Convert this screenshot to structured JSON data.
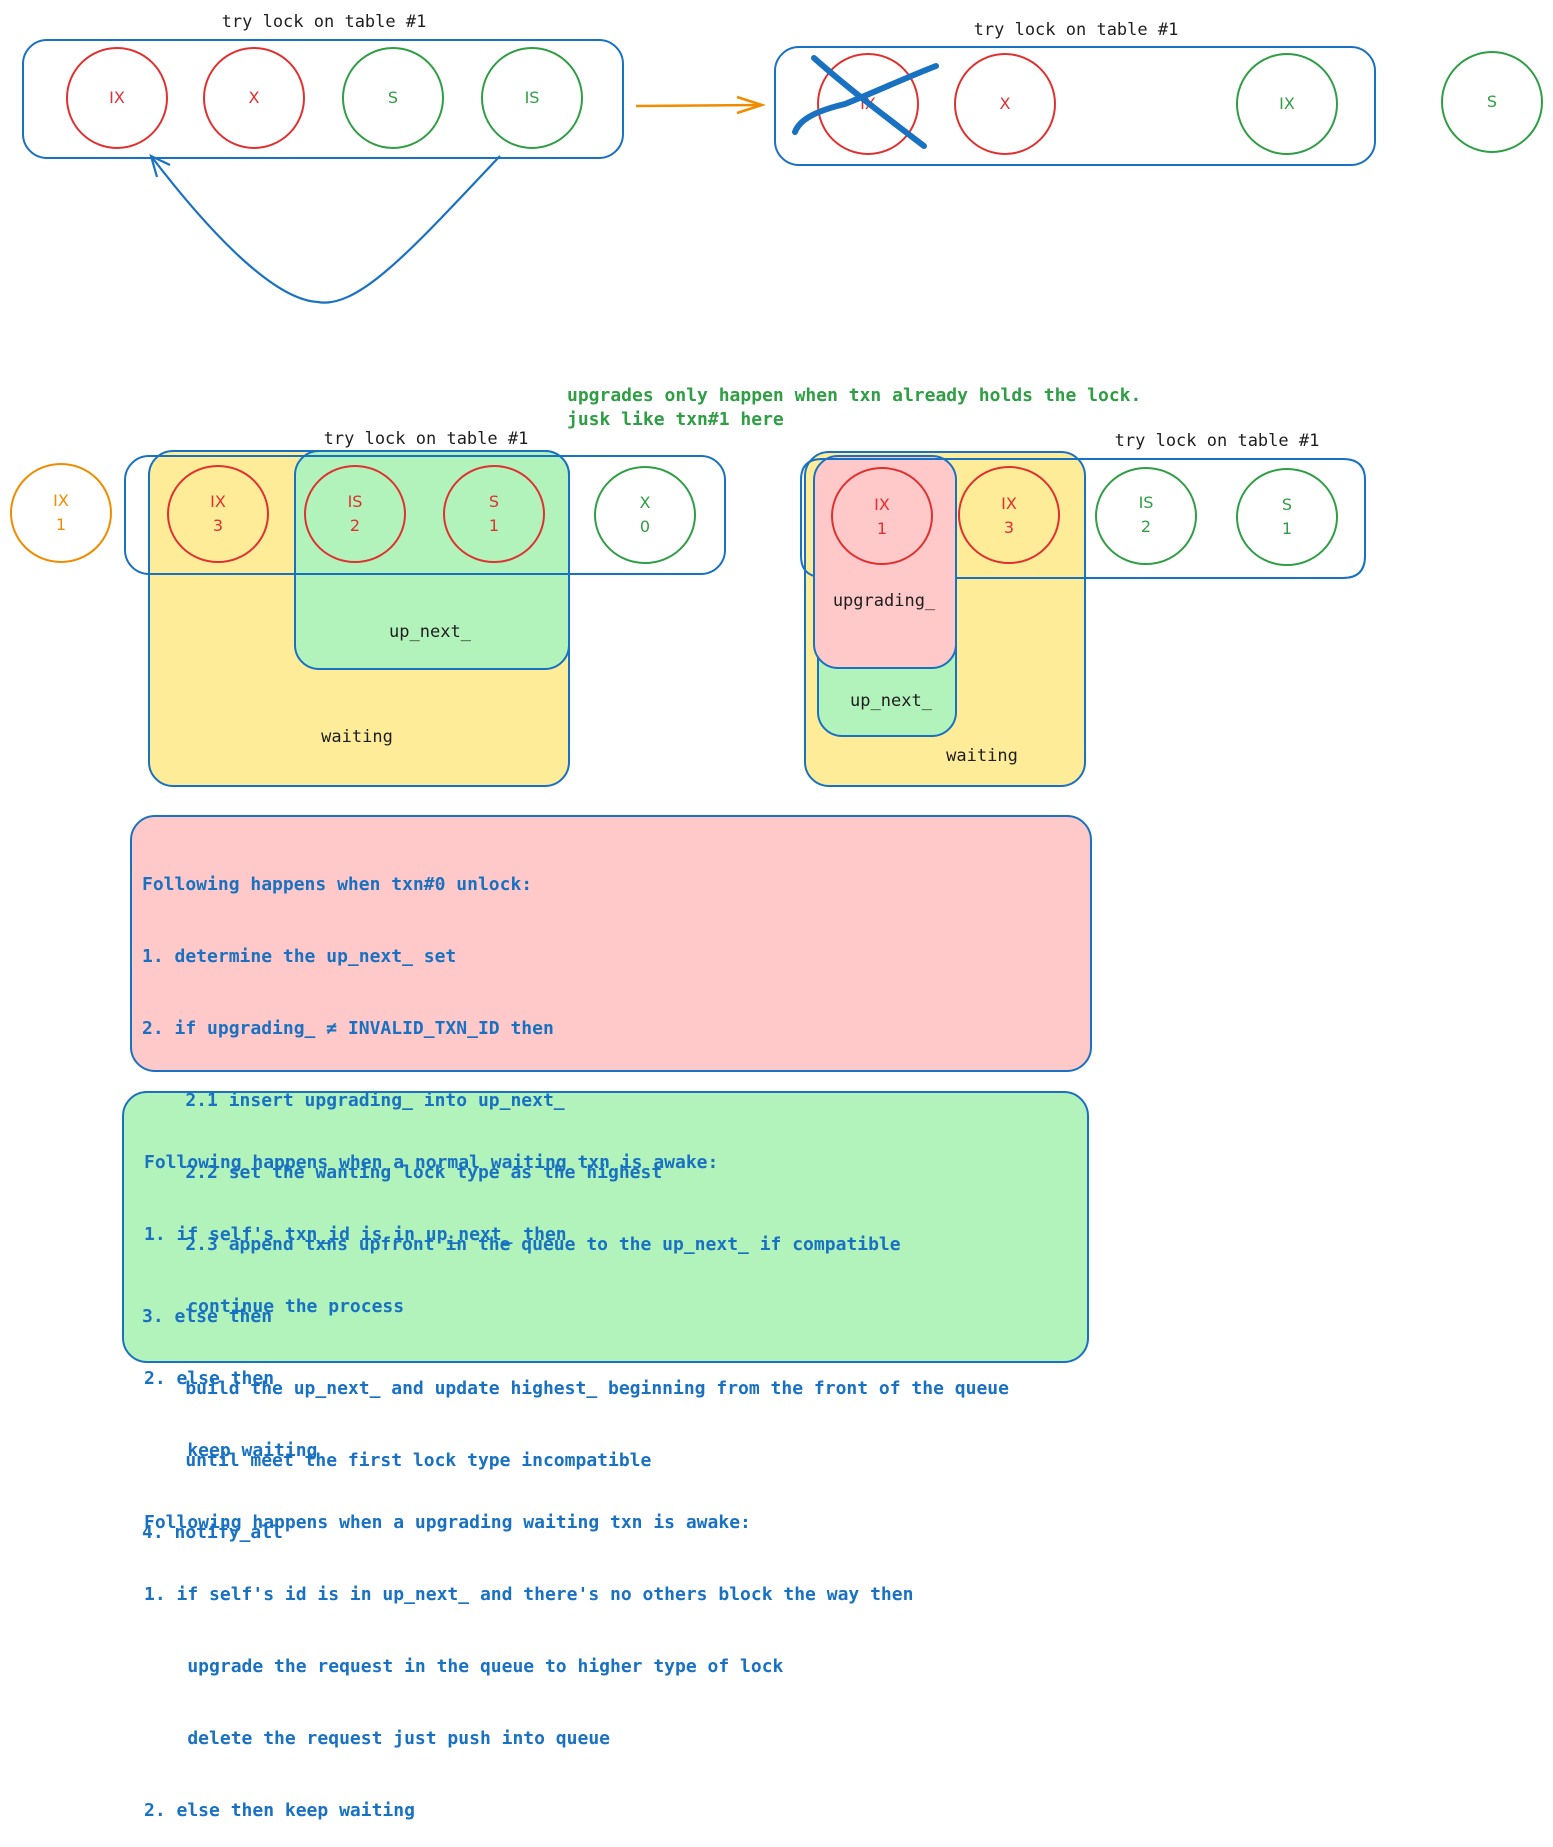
{
  "colors": {
    "blue": "#1971c2",
    "red": "#e03131",
    "green": "#2f9e44",
    "orange": "#f08c00",
    "yellow_fill": "#ffec99",
    "green_fill": "#b2f2bb",
    "pink_fill": "#ffc9c9"
  },
  "diagram1": {
    "title": "try lock on table #1",
    "locks": [
      {
        "type": "IX",
        "color": "red"
      },
      {
        "type": "X",
        "color": "red"
      },
      {
        "type": "S",
        "color": "green"
      },
      {
        "type": "IS",
        "color": "green"
      }
    ]
  },
  "diagram2": {
    "title": "try lock on table #1",
    "locks": [
      {
        "type": "IX",
        "color": "red",
        "crossed": true
      },
      {
        "type": "X",
        "color": "red"
      },
      {
        "type": "IX",
        "color": "green"
      }
    ],
    "outside_lock": {
      "type": "S",
      "color": "green"
    }
  },
  "annotation": {
    "line1": "upgrades only happen when txn already holds the lock.",
    "line2": "jusk like txn#1 here"
  },
  "diagram3": {
    "title": "try lock on table #1",
    "outside_lock": {
      "type": "IX",
      "txn": "1",
      "color": "orange"
    },
    "locks": [
      {
        "type": "IX",
        "txn": "3",
        "color": "red"
      },
      {
        "type": "IS",
        "txn": "2",
        "color": "red"
      },
      {
        "type": "S",
        "txn": "1",
        "color": "red"
      },
      {
        "type": "X",
        "txn": "0",
        "color": "green"
      }
    ],
    "up_next_label": "up_next_",
    "waiting_label": "waiting"
  },
  "diagram4": {
    "title": "try lock on table #1",
    "locks": [
      {
        "type": "IX",
        "txn": "1",
        "color": "red"
      },
      {
        "type": "IX",
        "txn": "3",
        "color": "red"
      },
      {
        "type": "IS",
        "txn": "2",
        "color": "green"
      },
      {
        "type": "S",
        "txn": "1",
        "color": "green"
      }
    ],
    "upgrading_label": "upgrading_",
    "up_next_label": "up_next_",
    "waiting_label": "waiting"
  },
  "unlock_note": {
    "lines": [
      "Following happens when txn#0 unlock:",
      "1. determine the up_next_ set",
      "2. if upgrading_ ≠ INVALID_TXN_ID then",
      "    2.1 insert upgrading_ into up_next_",
      "    2.2 set the wanting lock type as the highest",
      "    2.3 append txns upfront in the queue to the up_next_ if compatible",
      "3. else then",
      "    build the up_next_ and update highest_ beginning from the front of the queue",
      "    until meet the first lock type incompatible",
      "4. notify_all"
    ]
  },
  "awake_note": {
    "lines": [
      "Following happens when a normal waiting txn is awake:",
      "1. if self's txn_id is in up_next_ then",
      "    continue the process",
      "2. else then",
      "    keep waiting",
      "Following happens when a upgrading waiting txn is awake:",
      "1. if self's id is in up_next_ and there's no others block the way then",
      "    upgrade the request in the queue to higher type of lock",
      "    delete the request just push into queue",
      "2. else then keep waiting"
    ]
  }
}
